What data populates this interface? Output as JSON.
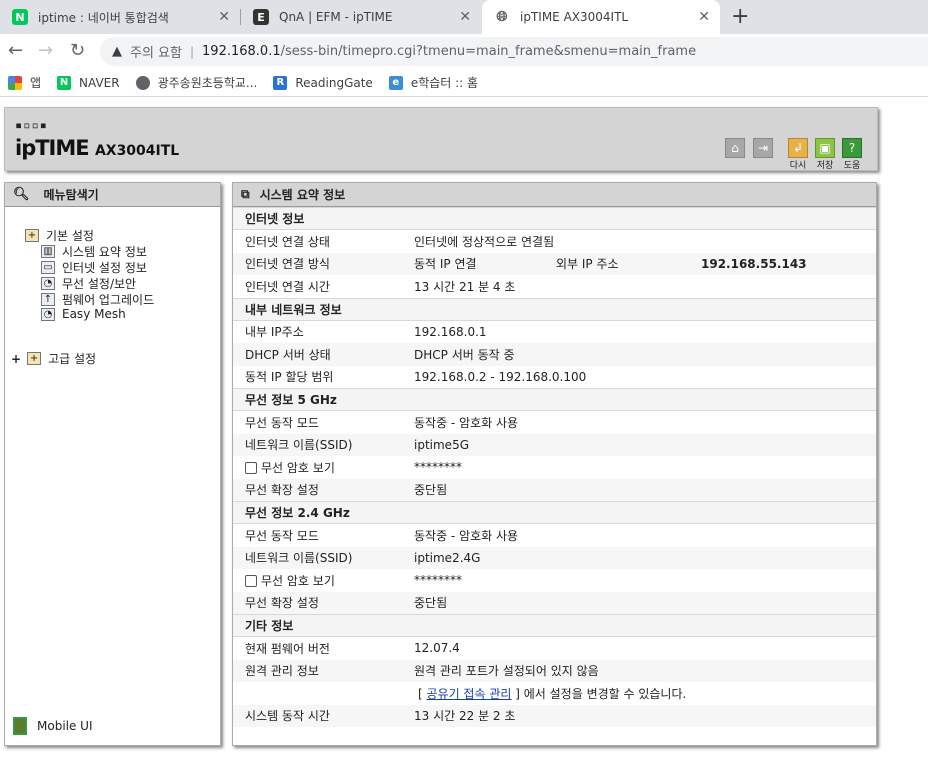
{
  "browser": {
    "tabs": [
      {
        "title": "iptime : 네이버 통합검색",
        "favicon": "naver-icon",
        "active": false
      },
      {
        "title": "QnA | EFM - ipTIME",
        "favicon": "efm-icon",
        "active": false
      },
      {
        "title": "ipTIME AX3004ITL",
        "favicon": "globe-icon",
        "active": true
      }
    ],
    "new_tab": "+",
    "close": "✕",
    "address": {
      "warning_label": "주의 요함",
      "host": "192.168.0.1",
      "path": "/sess-bin/timepro.cgi?tmenu=main_frame&smenu=main_frame"
    },
    "bookmarks": [
      {
        "label": "앱",
        "icon": "apps-grid-icon"
      },
      {
        "label": "NAVER",
        "icon": "naver-icon"
      },
      {
        "label": "광주송원초등학교...",
        "icon": "globe-icon"
      },
      {
        "label": "ReadingGate",
        "icon": "readinggate-icon"
      },
      {
        "label": "e학습터 :: 홈",
        "icon": "elearning-icon"
      }
    ]
  },
  "header": {
    "logo_dots": "▪▫▫▪",
    "logo": "ipTIME",
    "model": "AX3004ITL",
    "buttons": [
      {
        "label": "다시",
        "icon": "refresh-icon",
        "color": "#e8b24a"
      },
      {
        "label": "저장",
        "icon": "save-icon",
        "color": "#8dc24b"
      },
      {
        "label": "도움",
        "icon": "help-icon",
        "color": "#3b9b3b"
      }
    ]
  },
  "sidebar": {
    "title": "메뉴탐색기",
    "basic": {
      "label": "기본 설정",
      "items": [
        "시스템 요약 정보",
        "인터넷 설정 정보",
        "무선 설정/보안",
        "펌웨어 업그레이드",
        "Easy Mesh"
      ]
    },
    "advanced": {
      "label": "고급 설정",
      "expander": "+"
    },
    "mobile": "Mobile UI"
  },
  "main": {
    "title": "시스템 요약 정보",
    "sections": [
      {
        "title": "인터넷 정보",
        "rows": [
          {
            "k": "인터넷 연결 상태",
            "v": "인터넷에 정상적으로 연결됨"
          },
          {
            "k": "인터넷 연결 방식",
            "v": "동적 IP 연결",
            "k2": "외부 IP 주소",
            "v2": "192.168.55.143"
          },
          {
            "k": "인터넷 연결 시간",
            "v": "13 시간 21 분 4 초"
          }
        ]
      },
      {
        "title": "내부 네트워크 정보",
        "rows": [
          {
            "k": "내부 IP주소",
            "v": "192.168.0.1"
          },
          {
            "k": "DHCP 서버 상태",
            "v": "DHCP 서버 동작 중"
          },
          {
            "k": "동적 IP 할당 범위",
            "v": "192.168.0.2 -  192.168.0.100"
          }
        ]
      },
      {
        "title": "무선 정보 5 GHz",
        "rows": [
          {
            "k": "무선 동작 모드",
            "v": "동작중 - 암호화 사용"
          },
          {
            "k": "네트워크 이름(SSID)",
            "v": "iptime5G"
          },
          {
            "k": "무선 암호 보기",
            "v": "********",
            "checkbox": true
          },
          {
            "k": "무선 확장 설정",
            "v": "중단됨"
          }
        ]
      },
      {
        "title": "무선 정보 2.4 GHz",
        "rows": [
          {
            "k": "무선 동작 모드",
            "v": "동작중 - 암호화 사용"
          },
          {
            "k": "네트워크 이름(SSID)",
            "v": "iptime2.4G"
          },
          {
            "k": "무선 암호 보기",
            "v": "********",
            "checkbox": true
          },
          {
            "k": "무선 확장 설정",
            "v": "중단됨"
          }
        ]
      },
      {
        "title": "기타 정보",
        "rows": [
          {
            "k": "현재 펌웨어 버전",
            "v": "12.07.4"
          },
          {
            "k": "원격 관리 정보",
            "v": "원격 관리 포트가 설정되어 있지 않음"
          },
          {
            "k": "",
            "v": "",
            "link": "공유기 접속 관리",
            "suffix": " 에서 설정을 변경할 수 있습니다."
          },
          {
            "k": "시스템 동작 시간",
            "v": "13 시간 22 분 2 초"
          }
        ]
      }
    ]
  }
}
